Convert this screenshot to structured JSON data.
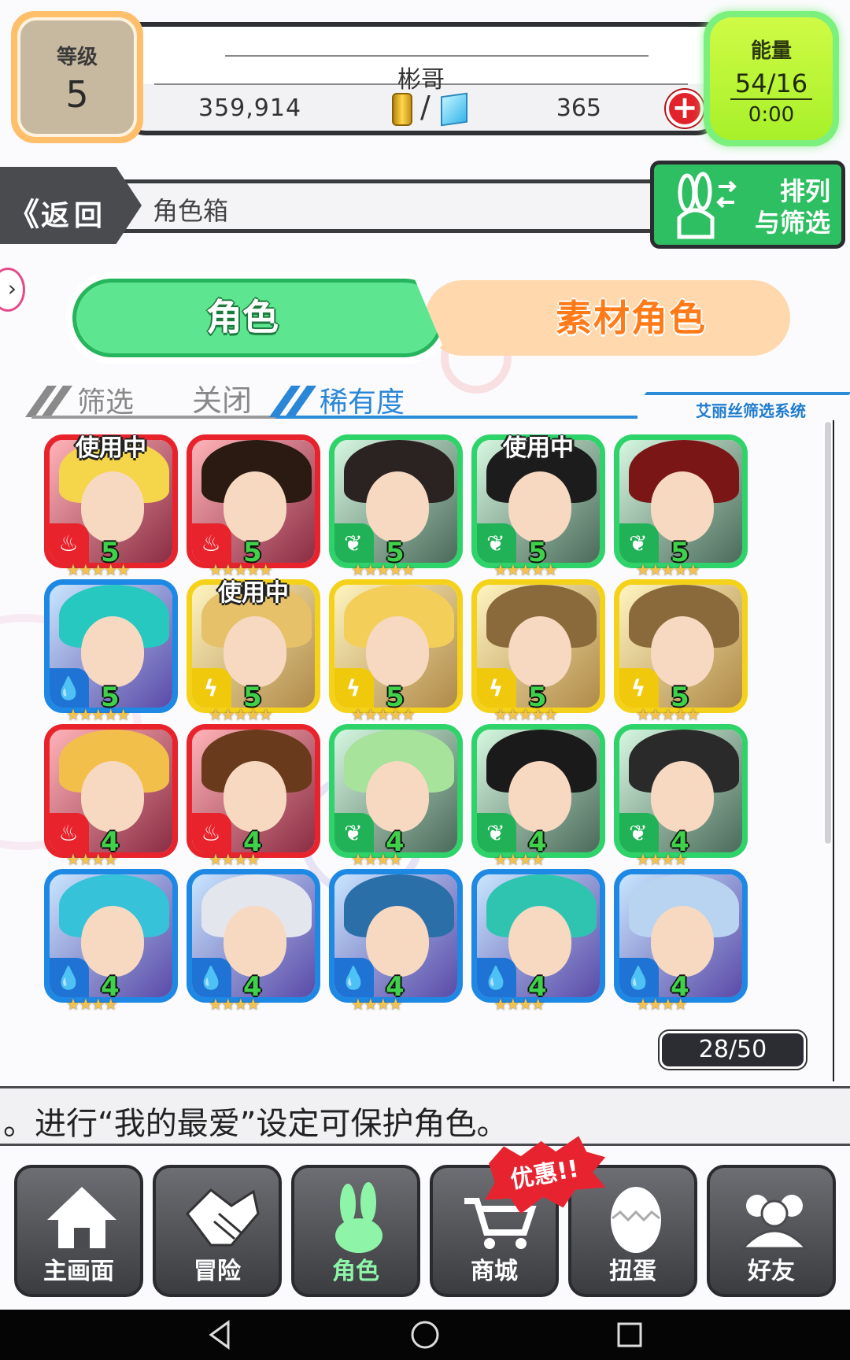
{
  "player": {
    "level_label": "等级",
    "level": "5",
    "name": "彬哥",
    "gold": "359,914",
    "currency_separator": "/",
    "gems": "365",
    "energy_label": "能量",
    "energy": "54/16",
    "energy_timer": "0:00"
  },
  "header": {
    "back_label": "返回",
    "back_chevron": "《",
    "title": "角色箱",
    "sort_label_1": "排列",
    "sort_label_2": "与筛选"
  },
  "tabs": {
    "characters": "角色",
    "materials": "素材角色"
  },
  "filter": {
    "label": "筛选",
    "state": "关闭",
    "sort_key": "稀有度",
    "system_label": "艾丽丝筛选系统"
  },
  "in_use_label": "使用中",
  "cards": [
    {
      "element": "fire",
      "level": "5",
      "stars": "★★★★★",
      "in_use": true,
      "hair": "#f5d64a"
    },
    {
      "element": "fire",
      "level": "5",
      "stars": "★★★★★",
      "in_use": false,
      "hair": "#2a1a12"
    },
    {
      "element": "wind",
      "level": "5",
      "stars": "★★★★★",
      "in_use": false,
      "hair": "#2b2222"
    },
    {
      "element": "wind",
      "level": "5",
      "stars": "★★★★★",
      "in_use": true,
      "hair": "#1c1c1c"
    },
    {
      "element": "wind",
      "level": "5",
      "stars": "★★★★★",
      "in_use": false,
      "hair": "#7a1616"
    },
    {
      "element": "water",
      "level": "5",
      "stars": "★★★★★",
      "in_use": false,
      "hair": "#27c8c0"
    },
    {
      "element": "thund",
      "level": "5",
      "stars": "★★★★★",
      "in_use": true,
      "hair": "#e6c16a"
    },
    {
      "element": "thund",
      "level": "5",
      "stars": "★★★★★",
      "in_use": false,
      "hair": "#f3cf5a"
    },
    {
      "element": "thund",
      "level": "5",
      "stars": "★★★★★",
      "in_use": false,
      "hair": "#8a6a3a"
    },
    {
      "element": "thund",
      "level": "5",
      "stars": "★★★★★",
      "in_use": false,
      "hair": "#8a6a3a"
    },
    {
      "element": "fire",
      "level": "4",
      "stars": "★★★★",
      "in_use": false,
      "hair": "#f2c04a"
    },
    {
      "element": "fire",
      "level": "4",
      "stars": "★★★★",
      "in_use": false,
      "hair": "#6a3a1c"
    },
    {
      "element": "wind",
      "level": "4",
      "stars": "★★★★",
      "in_use": false,
      "hair": "#a7e39a"
    },
    {
      "element": "wind",
      "level": "4",
      "stars": "★★★★",
      "in_use": false,
      "hair": "#1a1a1a"
    },
    {
      "element": "wind",
      "level": "4",
      "stars": "★★★★",
      "in_use": false,
      "hair": "#2a2a2a"
    },
    {
      "element": "water",
      "level": "4",
      "stars": "★★★★",
      "in_use": false,
      "hair": "#36c2d8"
    },
    {
      "element": "water",
      "level": "4",
      "stars": "★★★★",
      "in_use": false,
      "hair": "#e4e6ee"
    },
    {
      "element": "water",
      "level": "4",
      "stars": "★★★★",
      "in_use": false,
      "hair": "#2a6fa8"
    },
    {
      "element": "water",
      "level": "4",
      "stars": "★★★★",
      "in_use": false,
      "hair": "#2fc4b0"
    },
    {
      "element": "water",
      "level": "4",
      "stars": "★★★★",
      "in_use": false,
      "hair": "#b8d4f0"
    }
  ],
  "element_icons": {
    "fire": "flame-icon",
    "wind": "leaf-icon",
    "water": "droplet-icon",
    "thund": "lightning-icon"
  },
  "colors": {
    "fire": "#e8232c",
    "wind": "#2ed36a",
    "water": "#1e88e5",
    "thund": "#f5d21a"
  },
  "box_count": "28/50",
  "tip": "。进行“我的最爱”设定可保护角色。",
  "nav": {
    "home": "主画面",
    "adventure": "冒险",
    "characters": "角色",
    "shop": "商城",
    "gacha": "扭蛋",
    "friends": "好友",
    "deal_badge": "优惠!!"
  }
}
